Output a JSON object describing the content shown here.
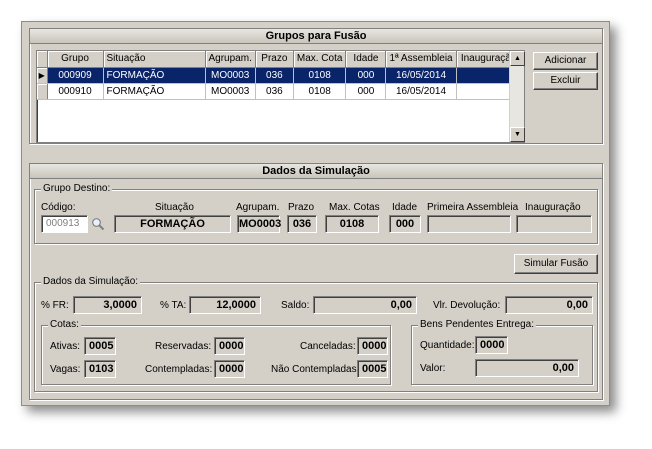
{
  "grupos": {
    "title": "Grupos para Fusão",
    "columns": [
      "Grupo",
      "Situação",
      "Agrupam.",
      "Prazo",
      "Max. Cota",
      "Idade",
      "1ª Assembleia",
      "Inauguração"
    ],
    "rows": [
      {
        "grupo": "000909",
        "situacao": "FORMAÇÃO",
        "agrupam": "MO0003",
        "prazo": "036",
        "max_cota": "0108",
        "idade": "000",
        "assembleia": "16/05/2014",
        "inauguracao": ""
      },
      {
        "grupo": "000910",
        "situacao": "FORMAÇÃO",
        "agrupam": "MO0003",
        "prazo": "036",
        "max_cota": "0108",
        "idade": "000",
        "assembleia": "16/05/2014",
        "inauguracao": ""
      }
    ],
    "add_label": "Adicionar",
    "delete_label": "Excluir"
  },
  "simulacao": {
    "title": "Dados da Simulação",
    "destino": {
      "group_label": "Grupo Destino:",
      "codigo_label": "Código:",
      "codigo_value": "000913",
      "situacao_label": "Situação",
      "situacao_value": "FORMAÇÃO",
      "agrupam_label": "Agrupam.",
      "agrupam_value": "MO0003",
      "prazo_label": "Prazo",
      "prazo_value": "036",
      "max_cotas_label": "Max. Cotas",
      "max_cotas_value": "0108",
      "idade_label": "Idade",
      "idade_value": "000",
      "assembleia_label": "Primeira Assembleia",
      "assembleia_value": "",
      "inauguracao_label": "Inauguração",
      "inauguracao_value": ""
    },
    "simular_label": "Simular Fusão",
    "dados": {
      "group_label": "Dados da Simulação:",
      "fr_label": "% FR:",
      "fr_value": "3,0000",
      "ta_label": "% TA:",
      "ta_value": "12,0000",
      "saldo_label": "Saldo:",
      "saldo_value": "0,00",
      "devolucao_label": "Vlr. Devolução:",
      "devolucao_value": "0,00"
    },
    "cotas": {
      "group_label": "Cotas:",
      "ativas_label": "Ativas:",
      "ativas_value": "0005",
      "vagas_label": "Vagas:",
      "vagas_value": "0103",
      "reservadas_label": "Reservadas:",
      "reservadas_value": "0000",
      "contempladas_label": "Contempladas:",
      "contempladas_value": "0000",
      "canceladas_label": "Canceladas:",
      "canceladas_value": "0000",
      "nao_contempladas_label": "Não Contempladas:",
      "nao_contempladas_value": "0005"
    },
    "bens": {
      "group_label": "Bens Pendentes Entrega:",
      "quantidade_label": "Quantidade:",
      "quantidade_value": "0000",
      "valor_label": "Valor:",
      "valor_value": "0,00"
    }
  }
}
